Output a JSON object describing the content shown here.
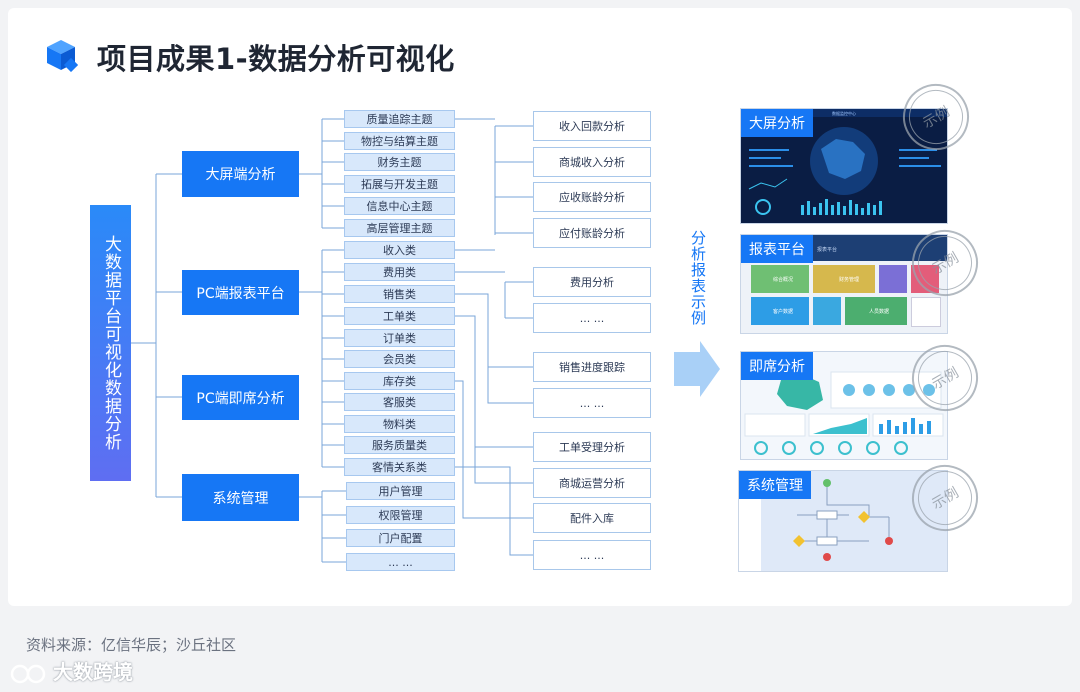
{
  "title": "项目成果1-数据分析可视化",
  "root": "大数据平台可视化数据分析",
  "categories": [
    "大屏端分析",
    "PC端报表平台",
    "PC端即席分析",
    "系统管理"
  ],
  "subjects": [
    "质量追踪主题",
    "物控与结算主题",
    "财务主题",
    "拓展与开发主题",
    "信息中心主题",
    "高层管理主题",
    "收入类",
    "费用类",
    "销售类",
    "工单类",
    "订单类",
    "会员类",
    "库存类",
    "客服类",
    "物料类",
    "服务质量类",
    "客情关系类",
    "用户管理",
    "权限管理",
    "门户配置",
    "... ..."
  ],
  "analyses": [
    "收入回款分析",
    "商城收入分析",
    "应收账龄分析",
    "应付账龄分析",
    "费用分析",
    "... ...",
    "销售进度跟踪",
    "... ...",
    "工单受理分析",
    "商城运营分析",
    "配件入库",
    "... ..."
  ],
  "side_label": "分析报表示例",
  "examples": [
    {
      "tag": "大屏分析",
      "stamp": "示例",
      "screen_title": "数据监控中心"
    },
    {
      "tag": "报表平台",
      "stamp": "示例",
      "screen_title": "报表平台",
      "tiles": [
        "综合概况",
        "财务管理",
        "",
        "",
        "客户数据",
        "",
        "人员数据",
        ""
      ]
    },
    {
      "tag": "即席分析",
      "stamp": "示例"
    },
    {
      "tag": "系统管理",
      "stamp": "示例"
    }
  ],
  "source": "资料来源：亿信华辰；沙丘社区",
  "watermark": "大数跨境",
  "colors": {
    "primary": "#1677f5",
    "light_box": "#d8e8fb",
    "line": "#7aa6d8"
  }
}
